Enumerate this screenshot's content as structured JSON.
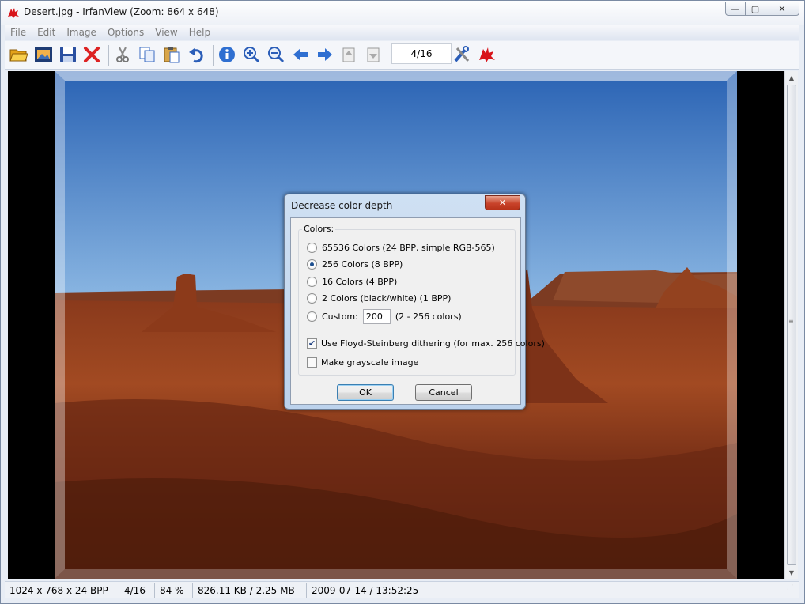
{
  "window": {
    "title": "Desert.jpg - IrfanView (Zoom: 864 x 648)",
    "min": "—",
    "max": "▢",
    "close": "✕"
  },
  "menu": [
    "File",
    "Edit",
    "Image",
    "Options",
    "View",
    "Help"
  ],
  "toolbar": {
    "page": "4/16"
  },
  "status": {
    "dimensions": "1024 x 768 x 24 BPP",
    "index": "4/16",
    "zoom": "84 %",
    "size": "826.11 KB / 2.25 MB",
    "date": "2009-07-14 / 13:52:25"
  },
  "dialog": {
    "title": "Decrease color depth",
    "group_label": "Colors:",
    "options": [
      {
        "label": "65536 Colors (24 BPP, simple RGB-565)",
        "checked": false
      },
      {
        "label": "256 Colors (8 BPP)",
        "checked": true
      },
      {
        "label": "16 Colors (4 BPP)",
        "checked": false
      },
      {
        "label": "2 Colors (black/white) (1 BPP)",
        "checked": false
      }
    ],
    "custom_label": "Custom:",
    "custom_value": "200",
    "custom_hint": "(2 - 256 colors)",
    "dither_label": "Use Floyd-Steinberg dithering (for max. 256 colors)",
    "dither_checked": true,
    "grayscale_label": "Make grayscale image",
    "grayscale_checked": false,
    "ok": "OK",
    "cancel": "Cancel"
  }
}
